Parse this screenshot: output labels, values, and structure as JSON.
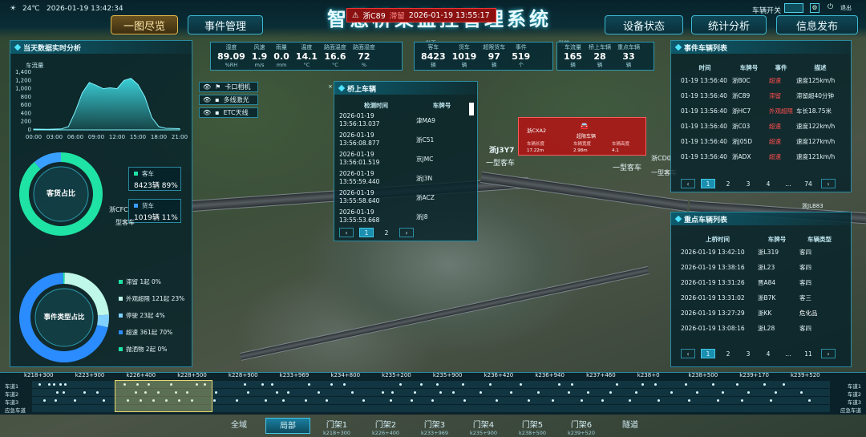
{
  "header": {
    "temperature": "24℃",
    "datetime": "2026-01-19 13:42:34",
    "title": "智慧桥梁监控管理系统",
    "alarm": {
      "plate": "浙C89",
      "event": "滞留",
      "time": "2026-01-19 13:55:17"
    },
    "switch_label": "车辆开关",
    "exit_label": "退出"
  },
  "nav": {
    "left": [
      "一图尽览",
      "事件管理"
    ],
    "right": [
      "设备状态",
      "统计分析",
      "信息发布"
    ],
    "active": "一图尽览"
  },
  "weather": {
    "metrics": [
      {
        "label": "湿度",
        "value": "89.09",
        "unit": "%RH"
      },
      {
        "label": "风速",
        "value": "1.9",
        "unit": "m/s"
      },
      {
        "label": "雨量",
        "value": "0.0",
        "unit": "mm"
      },
      {
        "label": "温度",
        "value": "14.1",
        "unit": "°C"
      },
      {
        "label": "路面温度",
        "value": "16.6",
        "unit": "°C"
      },
      {
        "label": "路面湿度",
        "value": "72",
        "unit": "%"
      }
    ]
  },
  "traffic_today": {
    "group_label": "当天",
    "metrics": [
      {
        "label": "客车",
        "value": "8423",
        "unit": "辆"
      },
      {
        "label": "货车",
        "value": "1019",
        "unit": "辆"
      },
      {
        "label": "超限货车",
        "value": "97",
        "unit": "辆"
      },
      {
        "label": "事件",
        "value": "519",
        "unit": "个"
      }
    ]
  },
  "traffic_current": {
    "group_label": "当前",
    "metrics": [
      {
        "label": "车流量",
        "value": "165",
        "unit": "辆"
      },
      {
        "label": "桥上车辆",
        "value": "28",
        "unit": "辆"
      },
      {
        "label": "重点车辆",
        "value": "33",
        "unit": "辆"
      }
    ]
  },
  "left_panel": {
    "title": "当天数据实时分析",
    "flow_label": "车流量",
    "flow_chart": {
      "type": "area",
      "x": [
        "00:00",
        "03:00",
        "06:00",
        "09:00",
        "12:00",
        "15:00",
        "18:00",
        "21:00"
      ],
      "y_ticks": [
        "0",
        "200",
        "400",
        "600",
        "800",
        "1,000",
        "1,200",
        "1,400"
      ],
      "ylim": [
        0,
        1400
      ],
      "points": [
        [
          0,
          20
        ],
        [
          2,
          15
        ],
        [
          4,
          25
        ],
        [
          5,
          80
        ],
        [
          6,
          450
        ],
        [
          7,
          900
        ],
        [
          8,
          1150
        ],
        [
          9,
          1080
        ],
        [
          10,
          1000
        ],
        [
          11,
          1020
        ],
        [
          12,
          1000
        ],
        [
          13,
          1200
        ],
        [
          14,
          1250
        ],
        [
          15,
          1100
        ],
        [
          16,
          800
        ],
        [
          17,
          300
        ],
        [
          18,
          80
        ],
        [
          19,
          40
        ],
        [
          21,
          30
        ]
      ]
    },
    "passenger_donut": {
      "center_label": "客货占比",
      "legend": [
        {
          "name": "客车",
          "count": "8423辆",
          "pct": "89%",
          "color": "#1fe3a4"
        },
        {
          "name": "货车",
          "count": "1019辆",
          "pct": "11%",
          "color": "#3aa0ff"
        }
      ],
      "values": [
        89,
        11
      ]
    },
    "event_donut": {
      "center_label": "事件类型占比",
      "legend": [
        {
          "name": "滞留",
          "count": "1起",
          "pct": "0%",
          "color": "#1fe3a4"
        },
        {
          "name": "外观超限",
          "count": "121起",
          "pct": "23%",
          "color": "#bff7e8"
        },
        {
          "name": "停驶",
          "count": "23起",
          "pct": "4%",
          "color": "#7fd0ff"
        },
        {
          "name": "超速",
          "count": "361起",
          "pct": "70%",
          "color": "#2a8cff"
        },
        {
          "name": "抛洒物",
          "count": "2起",
          "pct": "0%",
          "color": "#1fe3a4"
        }
      ],
      "values": [
        1,
        121,
        23,
        361,
        2
      ]
    }
  },
  "layers": [
    {
      "label": "卡口相机",
      "icon": "flag-icon"
    },
    {
      "label": "多线激光",
      "icon": "square-icon"
    },
    {
      "label": "ETC天线",
      "icon": "square-icon"
    }
  ],
  "bridge_vehicles": {
    "title": "桥上车辆",
    "columns": [
      "检测时间",
      "车牌号"
    ],
    "rows": [
      [
        "2026-01-19 13:56:13.037",
        "津MA9"
      ],
      [
        "2026-01-19 13:56:08.877",
        "浙C51"
      ],
      [
        "2026-01-19 13:56:01.519",
        "京JMC"
      ],
      [
        "2026-01-19 13:55:59.440",
        "浙J3N"
      ],
      [
        "2026-01-19 13:55:58.640",
        "浙ACZ"
      ],
      [
        "2026-01-19 13:55:53.668",
        "浙J8"
      ]
    ],
    "pages": [
      "1",
      "2"
    ],
    "current_page": "1"
  },
  "popup_card": {
    "plate": "浙CXA2",
    "fields": [
      {
        "label": "车辆长度",
        "value": "17.22m"
      },
      {
        "label": "车辆宽度",
        "value": "2.98m"
      },
      {
        "label": "车辆高度",
        "value": "4.1"
      }
    ]
  },
  "map_tags": [
    {
      "text": "浙J3Y7"
    },
    {
      "text": "一型客车"
    },
    {
      "text": "一型客车"
    },
    {
      "text": "浙CFC"
    },
    {
      "text": "型客车"
    },
    {
      "text": "浙JLB83"
    },
    {
      "text": "一型客车"
    },
    {
      "text": "浙CD0"
    }
  ],
  "event_list": {
    "title": "事件车辆列表",
    "columns": [
      "时间",
      "车牌号",
      "事件",
      "描述"
    ],
    "rows": [
      [
        "01-19 13:56:40",
        "浙B0C",
        "超速",
        "速度125km/h"
      ],
      [
        "01-19 13:56:40",
        "浙C89",
        "滞留",
        "滞留超40分钟"
      ],
      [
        "01-19 13:56:40",
        "浙HC7",
        "外观超限",
        "车长18.75米"
      ],
      [
        "01-19 13:56:40",
        "浙C03",
        "超速",
        "速度122km/h"
      ],
      [
        "01-19 13:56:40",
        "浙J05D",
        "超速",
        "速度127km/h"
      ],
      [
        "01-19 13:56:40",
        "浙ADX",
        "超速",
        "速度121km/h"
      ]
    ],
    "pages": [
      "1",
      "2",
      "3",
      "4",
      "...",
      "74"
    ],
    "current_page": "1"
  },
  "key_vehicles": {
    "title": "重点车辆列表",
    "columns": [
      "上桥时间",
      "车牌号",
      "车辆类型"
    ],
    "rows": [
      [
        "2026-01-19 13:42:10",
        "浙L319",
        "客四"
      ],
      [
        "2026-01-19 13:38:16",
        "浙L23",
        "客四"
      ],
      [
        "2026-01-19 13:31:26",
        "晋A84",
        "客四"
      ],
      [
        "2026-01-19 13:31:02",
        "浙B7K",
        "客三"
      ],
      [
        "2026-01-19 13:27:29",
        "浙KK",
        "危化品"
      ],
      [
        "2026-01-19 13:08:16",
        "浙L28",
        "客四"
      ]
    ],
    "pages": [
      "1",
      "2",
      "3",
      "4",
      "...",
      "11"
    ],
    "current_page": "1"
  },
  "timeline": {
    "km_marks": [
      "k218+300",
      "k223+900",
      "k226+400",
      "k228+500",
      "k228+900",
      "k233+969",
      "k234+800",
      "k235+200",
      "k235+900",
      "k236+420",
      "k236+940",
      "k237+460",
      "k238+0",
      "k238+500",
      "k239+170",
      "k239+520"
    ],
    "lanes": [
      "车道1",
      "车道2",
      "车道3",
      "应急车道"
    ]
  },
  "gantries": [
    {
      "name": "全域",
      "km": ""
    },
    {
      "name": "局部",
      "km": ""
    },
    {
      "name": "门架1",
      "km": "k218+300"
    },
    {
      "name": "门架2",
      "km": "k226+400"
    },
    {
      "name": "门架3",
      "km": "k233+969"
    },
    {
      "name": "门架4",
      "km": "k235+900"
    },
    {
      "name": "门架5",
      "km": "k238+500"
    },
    {
      "name": "门架6",
      "km": "k239+520"
    },
    {
      "name": "隧道",
      "km": ""
    }
  ],
  "active_gantry": "局部"
}
